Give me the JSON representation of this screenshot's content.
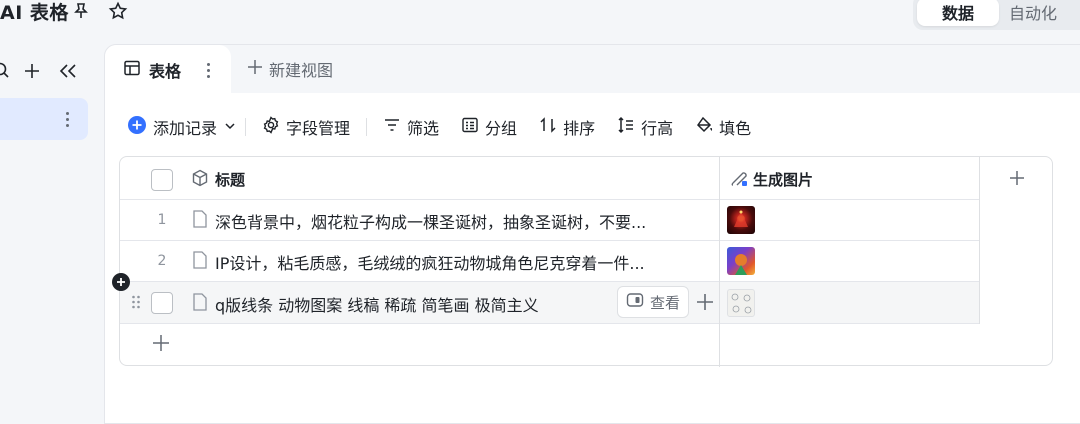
{
  "app": {
    "title": "AI 表格",
    "view_switch": {
      "data": "数据",
      "automation": "自动化"
    }
  },
  "tabs": {
    "active": "表格",
    "new_view": "新建视图"
  },
  "toolbar": {
    "add_record": "添加记录",
    "field_manage": "字段管理",
    "filter": "筛选",
    "group": "分组",
    "sort": "排序",
    "row_height": "行高",
    "fill_color": "填色"
  },
  "table": {
    "columns": {
      "title": "标题",
      "generated_image": "生成图片"
    },
    "rows": [
      {
        "num": "1",
        "title": "深色背景中，烟花粒子构成一棵圣诞树，抽象圣诞树，不要..."
      },
      {
        "num": "2",
        "title": "IP设计，粘毛质感，毛绒绒的疯狂动物城角色尼克穿着一件..."
      },
      {
        "num": "",
        "title": "q版线条 动物图案 线稿 稀疏 简笔画 极简主义"
      }
    ],
    "view_button": "查看"
  },
  "colors": {
    "accent": "#3370ff",
    "selected_bg": "#e1eaff"
  }
}
